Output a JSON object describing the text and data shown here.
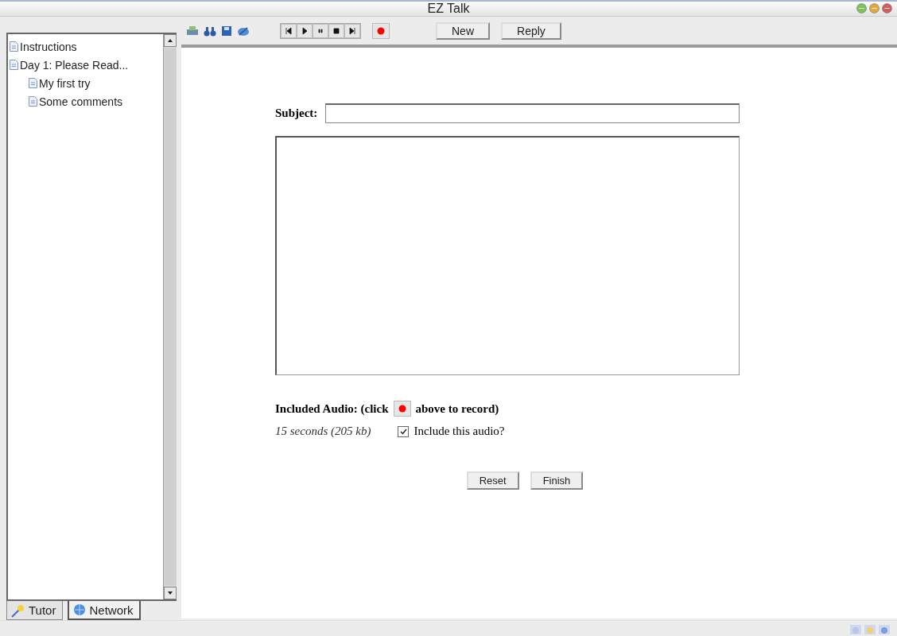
{
  "window": {
    "title": "EZ Talk"
  },
  "tree": [
    {
      "label": "Instructions"
    },
    {
      "label": "Day 1: Please Read...",
      "children": [
        {
          "label": "My first try"
        },
        {
          "label": "Some comments"
        }
      ]
    }
  ],
  "side_tabs": [
    {
      "label": "Tutor",
      "selected": false
    },
    {
      "label": "Network",
      "selected": true
    }
  ],
  "toolbar": {
    "buttons": [
      "New",
      "Reply"
    ]
  },
  "form": {
    "subject_label": "Subject:",
    "audio_heading_before": "Included Audio: (click",
    "audio_heading_after": "above to record)",
    "audio_info": "15 seconds (205 kb)",
    "include": {
      "label": "Include this audio?",
      "checked": true
    },
    "buttons": [
      "Reset",
      "Finish"
    ]
  }
}
